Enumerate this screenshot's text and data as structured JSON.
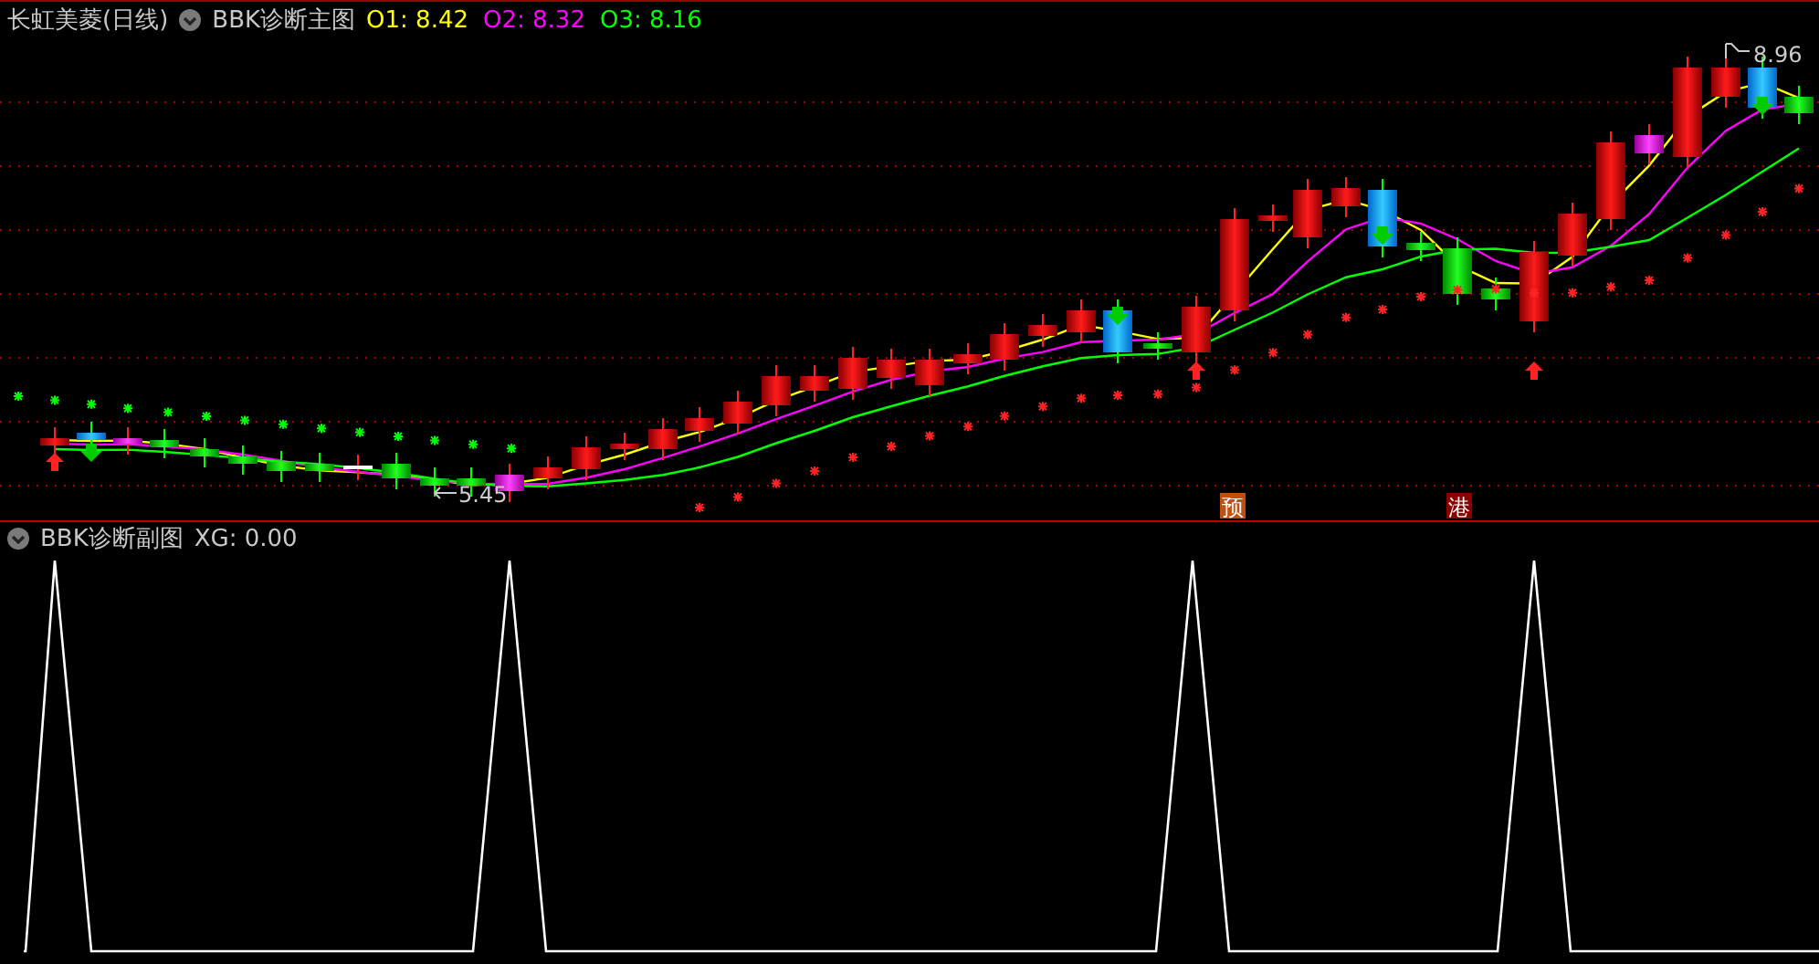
{
  "main": {
    "title": "长虹美菱(日线)",
    "indicator": "BBK诊断主图",
    "series": [
      {
        "label": "O1: 8.42",
        "color": "#ffff00"
      },
      {
        "label": "O2: 8.32",
        "color": "#ff00ff"
      },
      {
        "label": "O3: 8.16",
        "color": "#00ff00"
      }
    ],
    "high_label": "8.96",
    "low_label": "5.45",
    "signals": [
      {
        "text": "预",
        "color": "#c0500f"
      },
      {
        "text": "港",
        "color": "#8b0000"
      }
    ]
  },
  "sub": {
    "indicator": "BBK诊断副图",
    "reading": "XG: 0.00"
  }
}
